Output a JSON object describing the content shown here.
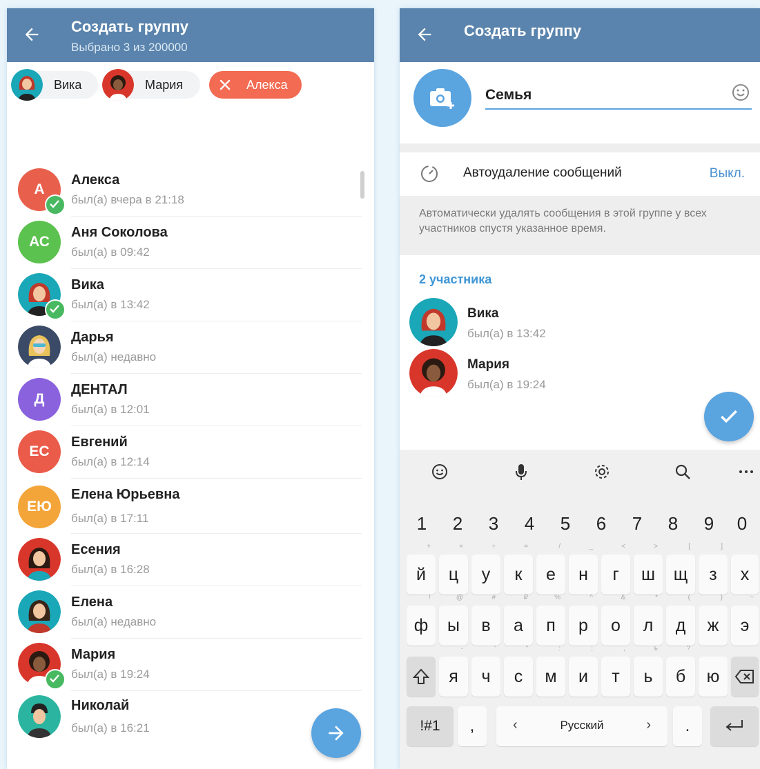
{
  "left": {
    "header": {
      "title": "Создать группу",
      "subtitle": "Выбрано 3 из 200000"
    },
    "chips": [
      {
        "label": "Вика"
      },
      {
        "label": "Мария"
      },
      {
        "label": "Алекса",
        "selected": true
      }
    ],
    "contacts": [
      {
        "name": "Алекса",
        "status": "был(а) вчера в 21:18",
        "initials": "А",
        "color": "#e8604c",
        "checked": true
      },
      {
        "name": "Аня Соколова",
        "status": "был(а) в 09:42",
        "initials": "АС",
        "color": "#5cc24f"
      },
      {
        "name": "Вика",
        "status": "был(а) в 13:42",
        "checked": true,
        "avatar": "vika"
      },
      {
        "name": "Дарья",
        "status": "был(а) недавно",
        "avatar": "darya"
      },
      {
        "name": "ДЕНТАЛ",
        "status": "был(а) в 12:01",
        "initials": "Д",
        "color": "#8a62dd"
      },
      {
        "name": "Евгений",
        "status": "был(а) в 12:14",
        "initials": "ЕС",
        "color": "#ea5b4a"
      },
      {
        "name": "Елена Юрьевна",
        "status": "был(а) в 17:11",
        "initials": "ЕЮ",
        "color": "#f4a53a"
      },
      {
        "name": "Есения",
        "status": "был(а) в 16:28",
        "avatar": "esenia"
      },
      {
        "name": "Елена",
        "status": "был(а) недавно",
        "avatar": "elena"
      },
      {
        "name": "Мария",
        "status": "был(а) в 19:24",
        "checked": true,
        "avatar": "maria"
      },
      {
        "name": "Николай",
        "status": "был(а) в 16:21",
        "avatar": "nikolay"
      }
    ]
  },
  "right": {
    "header": {
      "title": "Создать группу"
    },
    "group_name": "Семья",
    "autodelete": {
      "label": "Автоудаление сообщений",
      "value": "Выкл.",
      "hint": "Автоматически удалять сообщения в этой группе у всех участников спустя указанное время."
    },
    "members_count": "2 участника",
    "members": [
      {
        "name": "Вика",
        "status": "был(а) в 13:42"
      },
      {
        "name": "Мария",
        "status": "был(а) в 19:24"
      }
    ],
    "keyboard": {
      "toolbar": [
        "emoji-icon",
        "microphone-icon",
        "settings-icon",
        "search-icon",
        "more-icon"
      ],
      "numbers": [
        "1",
        "2",
        "3",
        "4",
        "5",
        "6",
        "7",
        "8",
        "9",
        "0"
      ],
      "row1": [
        "й",
        "ц",
        "у",
        "к",
        "е",
        "н",
        "г",
        "ш",
        "щ",
        "з",
        "х"
      ],
      "row1_hints": [
        "+",
        "×",
        "÷",
        "=",
        "/",
        "_",
        "<",
        ">",
        "[",
        "]",
        ""
      ],
      "row2": [
        "ф",
        "ы",
        "в",
        "а",
        "п",
        "р",
        "о",
        "л",
        "д",
        "ж",
        "э"
      ],
      "row2_hints": [
        "!",
        "@",
        "#",
        "₽",
        "%",
        "^",
        "&",
        "*",
        "(",
        ")",
        "~"
      ],
      "row3": [
        "я",
        "ч",
        "с",
        "м",
        "и",
        "т",
        "ь",
        "б",
        "ю"
      ],
      "row3_hints": [
        "-",
        "'",
        "\"",
        ":",
        ";",
        ",",
        "ъ",
        "?",
        ""
      ],
      "symbols_key": "!#1",
      "comma": ",",
      "language": "Русский",
      "period": "."
    }
  }
}
